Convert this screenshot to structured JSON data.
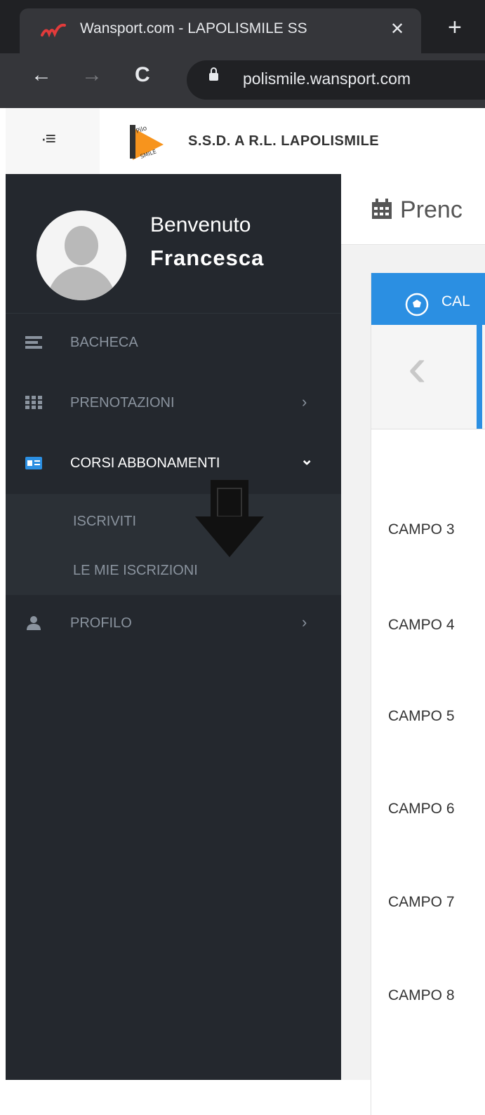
{
  "browser": {
    "tab_title": "Wansport.com - LAPOLISMILE SS",
    "tab_close": "✕",
    "new_tab": "+",
    "back": "←",
    "forward": "→",
    "reload": "C",
    "url": "polismile.wansport.com"
  },
  "header": {
    "toggle": "·≡",
    "brand_name": "S.S.D. A R.L. LAPOLISMILE"
  },
  "user": {
    "welcome": "Benvenuto",
    "name": "Francesca"
  },
  "sidebar": {
    "items": [
      {
        "label": "BACHECA",
        "icon": "list-icon",
        "chevron": ""
      },
      {
        "label": "PRENOTAZIONI",
        "icon": "grid-icon",
        "chevron": "›"
      },
      {
        "label": "CORSI ABBONAMENTI",
        "icon": "id-card-icon",
        "chevron": "⌄",
        "active": true
      },
      {
        "label": "PROFILO",
        "icon": "user-icon",
        "chevron": "›"
      }
    ],
    "submenu": [
      {
        "label": "ISCRIVITI"
      },
      {
        "label": "LE MIE ISCRIZIONI"
      }
    ]
  },
  "main": {
    "page_title": "Prenc",
    "tab_label": "CAL",
    "prev": "‹",
    "rows": [
      "CAMPO 3",
      "CAMPO 4",
      "CAMPO 5",
      "CAMPO 6",
      "CAMPO 7",
      "CAMPO 8"
    ]
  },
  "colors": {
    "sidebar_bg": "#24282e",
    "accent_blue": "#2b8fe2",
    "chrome_dark": "#202124"
  }
}
